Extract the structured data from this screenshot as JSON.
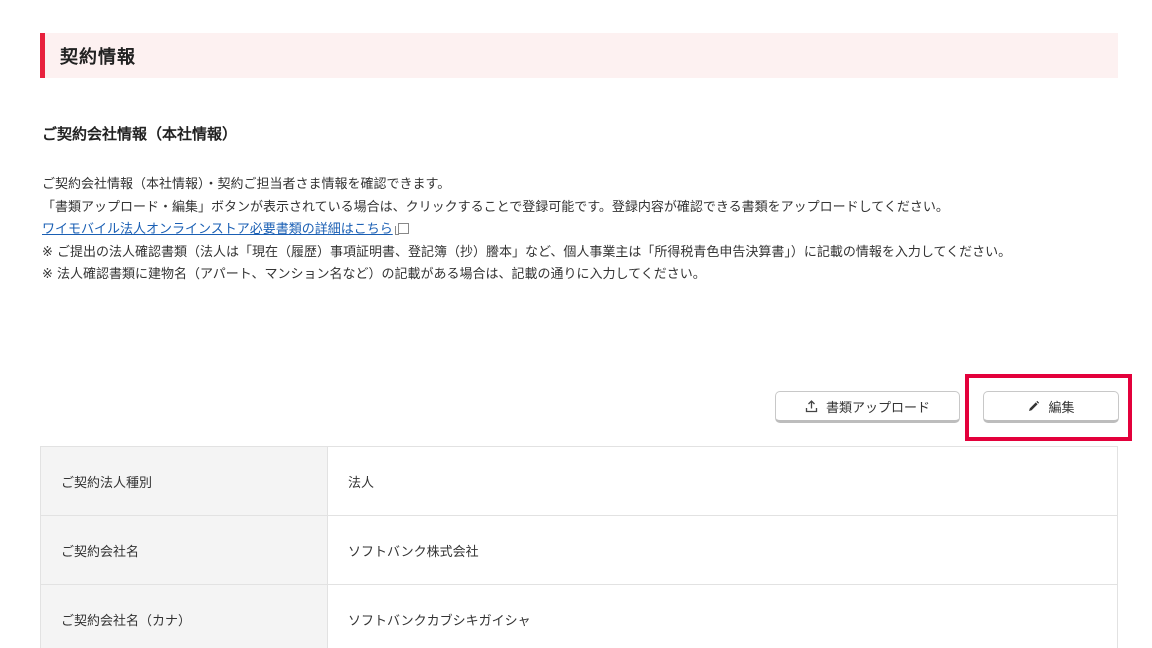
{
  "section": {
    "title": "契約情報"
  },
  "subsection": {
    "title": "ご契約会社情報（本社情報）"
  },
  "description": {
    "line1": "ご契約会社情報（本社情報）・契約ご担当者さま情報を確認できます。",
    "line2": "「書類アップロード・編集」ボタンが表示されている場合は、クリックすることで登録可能です。登録内容が確認できる書類をアップロードしてください。",
    "link_text": "ワイモバイル法人オンラインストア必要書類の詳細はこちら",
    "note1": "※ ご提出の法人確認書類（法人は「現在（履歴）事項証明書、登記簿（抄）謄本」など、個人事業主は「所得税青色申告決算書」）に記載の情報を入力してください。",
    "note2": "※ 法人確認書類に建物名（アパート、マンション名など）の記載がある場合は、記載の通りに入力してください。"
  },
  "buttons": {
    "upload_label": "書類アップロード",
    "edit_label": "編集"
  },
  "table": {
    "rows": [
      {
        "label": "ご契約法人種別",
        "value": "法人"
      },
      {
        "label": "ご契約会社名",
        "value": "ソフトバンク株式会社"
      },
      {
        "label": "ご契約会社名（カナ）",
        "value": "ソフトバンクカブシキガイシャ"
      }
    ]
  },
  "colors": {
    "accent": "#e8213d",
    "header_bg": "#fdf1f1",
    "highlight": "#e3003b",
    "link": "#1a5fb4"
  }
}
